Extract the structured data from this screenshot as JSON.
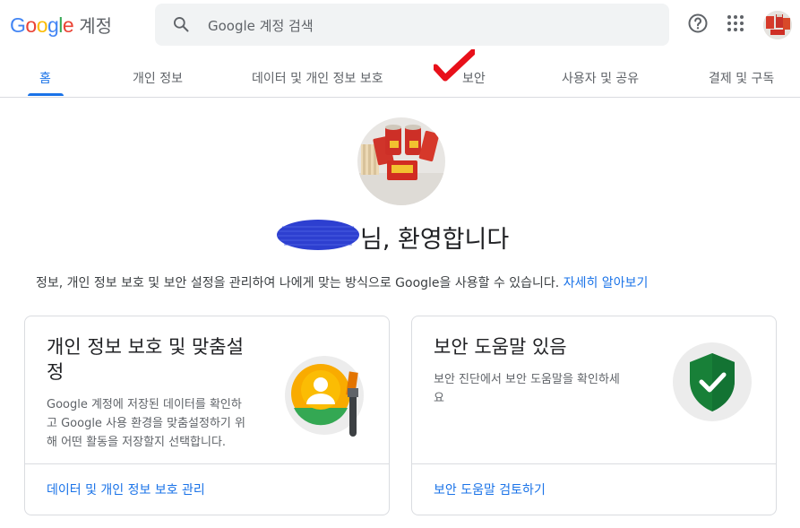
{
  "header": {
    "logo_letters": [
      "G",
      "o",
      "o",
      "g",
      "l",
      "e"
    ],
    "product": "계정",
    "search_placeholder": "Google 계정 검색",
    "icons": [
      "search-icon",
      "help-icon",
      "apps-grid-icon"
    ]
  },
  "tabs": [
    {
      "label": "홈",
      "active": true
    },
    {
      "label": "개인 정보",
      "active": false
    },
    {
      "label": "데이터 및 개인 정보 보호",
      "active": false
    },
    {
      "label": "보안",
      "active": false
    },
    {
      "label": "사용자 및 공유",
      "active": false
    },
    {
      "label": "결제 및 구독",
      "active": false
    }
  ],
  "welcome": {
    "greeting_suffix": "님, 환영합니다",
    "subtitle": "정보, 개인 정보 보호 및 보안 설정을 관리하여 나에게 맞는 방식으로 Google을 사용할 수 있습니다.",
    "learn_more": "자세히 알아보기"
  },
  "cards": [
    {
      "title_line1": "개인 정보 보호 및 맞춤설",
      "title_line2": "정",
      "desc_lines": [
        "Google 계정에 저장된 데이터를 확인하",
        "고 Google 사용 환경을 맞춤설정하기 위",
        "해 어떤 활동을 저장할지 선택합니다."
      ],
      "link": "데이터 및 개인 정보 보호 관리"
    },
    {
      "title_line1": "보안 도움말 있음",
      "desc_lines": [
        "보안 진단에서 보안 도움말을 확인하세",
        "요"
      ],
      "link": "보안 도움말 검토하기"
    }
  ],
  "colors": {
    "accent": "#1a73e8",
    "annotation_check": "#e8101a",
    "redaction_scribble": "#2d3fd0",
    "shield": "#188038"
  }
}
